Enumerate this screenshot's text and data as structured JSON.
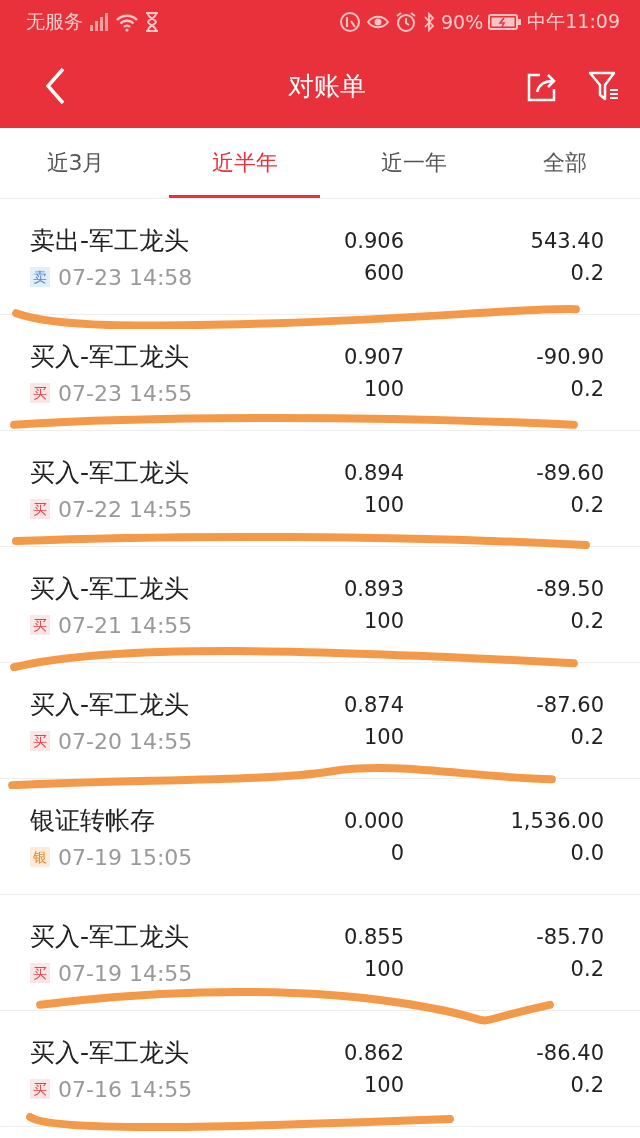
{
  "status_bar": {
    "carrier": "无服务",
    "battery": "90%",
    "time": "中午11:09"
  },
  "header": {
    "title": "对账单"
  },
  "tabs": [
    {
      "label": "近3月",
      "selected": false
    },
    {
      "label": "近半年",
      "selected": true
    },
    {
      "label": "近一年",
      "selected": false
    },
    {
      "label": "全部",
      "selected": false
    }
  ],
  "records": [
    {
      "name": "卖出-军工龙头",
      "kind": "sell",
      "badge": "卖",
      "time": "07-23 14:58",
      "price": "0.906",
      "quantity": "600",
      "amount": "543.40",
      "fee": "0.2",
      "marked": true
    },
    {
      "name": "买入-军工龙头",
      "kind": "buy",
      "badge": "买",
      "time": "07-23 14:55",
      "price": "0.907",
      "quantity": "100",
      "amount": "-90.90",
      "fee": "0.2",
      "marked": true
    },
    {
      "name": "买入-军工龙头",
      "kind": "buy",
      "badge": "买",
      "time": "07-22 14:55",
      "price": "0.894",
      "quantity": "100",
      "amount": "-89.60",
      "fee": "0.2",
      "marked": true
    },
    {
      "name": "买入-军工龙头",
      "kind": "buy",
      "badge": "买",
      "time": "07-21 14:55",
      "price": "0.893",
      "quantity": "100",
      "amount": "-89.50",
      "fee": "0.2",
      "marked": true
    },
    {
      "name": "买入-军工龙头",
      "kind": "buy",
      "badge": "买",
      "time": "07-20 14:55",
      "price": "0.874",
      "quantity": "100",
      "amount": "-87.60",
      "fee": "0.2",
      "marked": true
    },
    {
      "name": "银证转帐存",
      "kind": "bank",
      "badge": "银",
      "time": "07-19 15:05",
      "price": "0.000",
      "quantity": "0",
      "amount": "1,536.00",
      "fee": "0.0",
      "marked": false
    },
    {
      "name": "买入-军工龙头",
      "kind": "buy",
      "badge": "买",
      "time": "07-19 14:55",
      "price": "0.855",
      "quantity": "100",
      "amount": "-85.70",
      "fee": "0.2",
      "marked": true
    },
    {
      "name": "买入-军工龙头",
      "kind": "buy",
      "badge": "买",
      "time": "07-16 14:55",
      "price": "0.862",
      "quantity": "100",
      "amount": "-86.40",
      "fee": "0.2",
      "marked": true
    }
  ]
}
